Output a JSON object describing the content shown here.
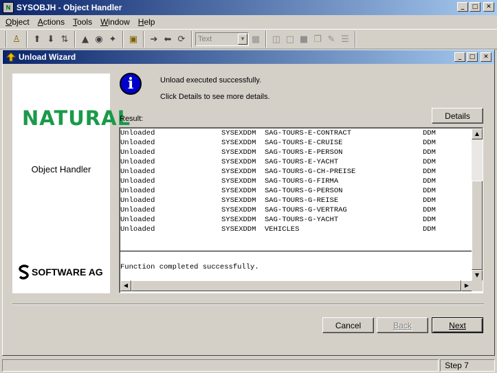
{
  "window": {
    "title": "SYSOBJH - Object Handler",
    "icon_text": "N",
    "controls": [
      "_",
      "□",
      "✕"
    ]
  },
  "menu": [
    {
      "label": "Object",
      "accel": "O",
      "rest": "bject"
    },
    {
      "label": "Actions",
      "accel": "A",
      "rest": "ctions"
    },
    {
      "label": "Tools",
      "accel": "T",
      "rest": "ools"
    },
    {
      "label": "Window",
      "accel": "W",
      "rest": "indow"
    },
    {
      "label": "Help",
      "accel": "H",
      "rest": "elp"
    }
  ],
  "toolbar": {
    "select_value": "Text"
  },
  "wizard": {
    "title": "Unload Wizard",
    "controls": [
      "_",
      "□",
      "✕"
    ],
    "brand_name": "NATURAL",
    "brand_sub": "Object Handler",
    "vendor": "SOFTWARE AG",
    "info_glyph": "i",
    "message_line1": "Unload executed successfully.",
    "message_line2": "Click Details to see more details.",
    "result_label": "Result:",
    "details_button": "Details",
    "rows": [
      {
        "status": "Unloaded",
        "library": "SYSEXDDM",
        "object": "SAG-TOURS-E-CONTRACT",
        "type": "DDM"
      },
      {
        "status": "Unloaded",
        "library": "SYSEXDDM",
        "object": "SAG-TOURS-E-CRUISE",
        "type": "DDM"
      },
      {
        "status": "Unloaded",
        "library": "SYSEXDDM",
        "object": "SAG-TOURS-E-PERSON",
        "type": "DDM"
      },
      {
        "status": "Unloaded",
        "library": "SYSEXDDM",
        "object": "SAG-TOURS-E-YACHT",
        "type": "DDM"
      },
      {
        "status": "Unloaded",
        "library": "SYSEXDDM",
        "object": "SAG-TOURS-G-CH-PREISE",
        "type": "DDM"
      },
      {
        "status": "Unloaded",
        "library": "SYSEXDDM",
        "object": "SAG-TOURS-G-FIRMA",
        "type": "DDM"
      },
      {
        "status": "Unloaded",
        "library": "SYSEXDDM",
        "object": "SAG-TOURS-G-PERSON",
        "type": "DDM"
      },
      {
        "status": "Unloaded",
        "library": "SYSEXDDM",
        "object": "SAG-TOURS-G-REISE",
        "type": "DDM"
      },
      {
        "status": "Unloaded",
        "library": "SYSEXDDM",
        "object": "SAG-TOURS-G-VERTRAG",
        "type": "DDM"
      },
      {
        "status": "Unloaded",
        "library": "SYSEXDDM",
        "object": "SAG-TOURS-G-YACHT",
        "type": "DDM"
      },
      {
        "status": "Unloaded",
        "library": "SYSEXDDM",
        "object": "VEHICLES",
        "type": "DDM"
      }
    ],
    "function_message": "Function completed successfully.",
    "cancel_button": "Cancel",
    "back_button": "Back",
    "next_button": "Next"
  },
  "status_bar": {
    "step": "Step 7"
  },
  "colors": {
    "title_gradient_start": "#0a246a",
    "title_gradient_end": "#a6caf0",
    "face": "#d4d0c8",
    "brand_green": "#1a9a4a",
    "info_blue": "#0000cc"
  }
}
